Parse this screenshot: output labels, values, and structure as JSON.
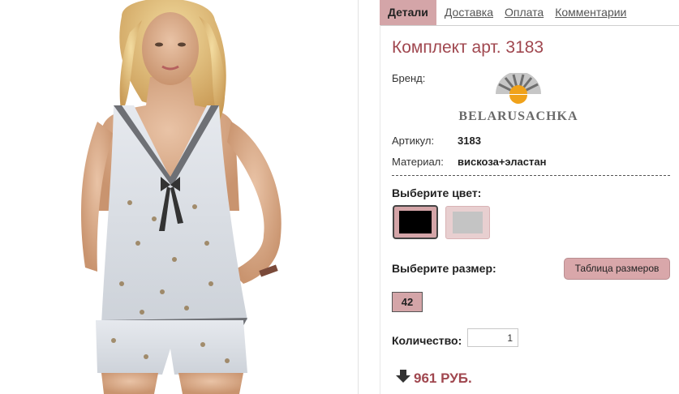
{
  "tabs": [
    {
      "label": "Детали",
      "active": true
    },
    {
      "label": "Доставка",
      "active": false
    },
    {
      "label": "Оплата",
      "active": false
    },
    {
      "label": "Комментарии",
      "active": false
    }
  ],
  "product": {
    "title": "Комплект арт. 3183",
    "brand_label": "Бренд:",
    "brand_logo_text": "BELARUSACHKA",
    "article_label": "Артикул:",
    "article_value": "3183",
    "material_label": "Материал:",
    "material_value": "вискоза+эластан"
  },
  "color": {
    "label": "Выберите цвет:",
    "options": [
      {
        "name": "black",
        "hex": "#000000",
        "selected": true
      },
      {
        "name": "grey",
        "hex": "#c4c4c4",
        "selected": false
      }
    ]
  },
  "size": {
    "label": "Выберите размер:",
    "table_button": "Таблица размеров",
    "options": [
      "42"
    ]
  },
  "quantity": {
    "label": "Количество:",
    "value": "1"
  },
  "price": {
    "text": "961 РУБ.",
    "icon": "down-arrow-icon"
  },
  "colors": {
    "accent": "#d4a5a8",
    "title": "#a0474f"
  }
}
